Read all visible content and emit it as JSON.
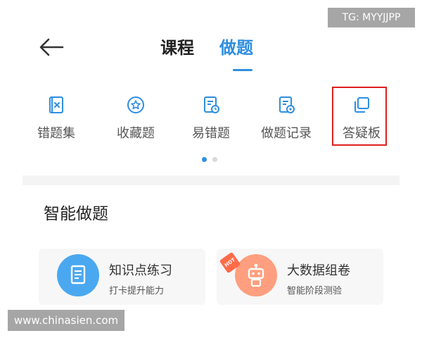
{
  "watermark_top": "TG: MYYJJPP",
  "watermark_bottom": "www.chinasien.com",
  "header": {
    "tabs": [
      {
        "label": "课程",
        "active": false
      },
      {
        "label": "做题",
        "active": true
      }
    ]
  },
  "nav": {
    "items": [
      {
        "label": "错题集",
        "icon": "wrong-book-icon"
      },
      {
        "label": "收藏题",
        "icon": "star-circle-icon"
      },
      {
        "label": "易错题",
        "icon": "document-clock-icon"
      },
      {
        "label": "做题记录",
        "icon": "record-icon"
      },
      {
        "label": "答疑板",
        "icon": "stacked-squares-icon"
      }
    ],
    "page_count": 2,
    "active_page": 0
  },
  "section": {
    "title": "智能做题"
  },
  "cards": [
    {
      "title": "知识点练习",
      "subtitle": "打卡提升能力",
      "color": "#4aa8f0"
    },
    {
      "title": "大数据组卷",
      "subtitle": "智能阶段测验",
      "color": "#ff9f7f",
      "badge": "HOT"
    }
  ],
  "colors": {
    "accent": "#2e8ee0",
    "highlight": "#e02020"
  }
}
